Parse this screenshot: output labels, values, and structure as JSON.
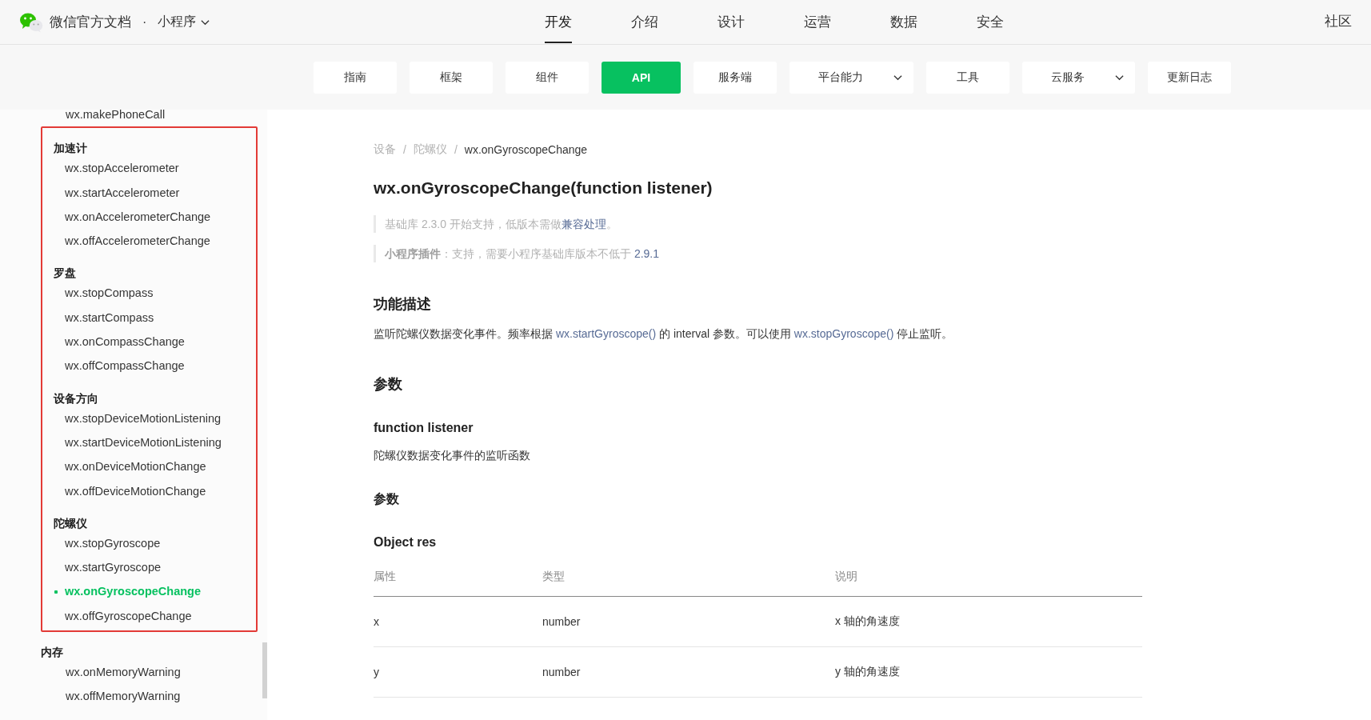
{
  "header": {
    "brand": "微信官方文档",
    "separator": "·",
    "product": "小程序",
    "community": "社区",
    "nav": [
      {
        "label": "开发",
        "selected": true
      },
      {
        "label": "介绍",
        "selected": false
      },
      {
        "label": "设计",
        "selected": false
      },
      {
        "label": "运营",
        "selected": false
      },
      {
        "label": "数据",
        "selected": false
      },
      {
        "label": "安全",
        "selected": false
      }
    ]
  },
  "subnav": [
    {
      "label": "指南",
      "selected": false,
      "dropdown": false
    },
    {
      "label": "框架",
      "selected": false,
      "dropdown": false
    },
    {
      "label": "组件",
      "selected": false,
      "dropdown": false
    },
    {
      "label": "API",
      "selected": true,
      "dropdown": false
    },
    {
      "label": "服务端",
      "selected": false,
      "dropdown": false
    },
    {
      "label": "平台能力",
      "selected": false,
      "dropdown": true
    },
    {
      "label": "工具",
      "selected": false,
      "dropdown": false
    },
    {
      "label": "云服务",
      "selected": false,
      "dropdown": true
    },
    {
      "label": "更新日志",
      "selected": false,
      "dropdown": false
    }
  ],
  "sidebar": {
    "groups": [
      {
        "highlighted": false,
        "items": [
          {
            "label": "wx.makePhoneCall",
            "selected": false
          }
        ]
      },
      {
        "title": "加速计",
        "highlighted": true,
        "items": [
          {
            "label": "wx.stopAccelerometer",
            "selected": false
          },
          {
            "label": "wx.startAccelerometer",
            "selected": false
          },
          {
            "label": "wx.onAccelerometerChange",
            "selected": false
          },
          {
            "label": "wx.offAccelerometerChange",
            "selected": false
          }
        ]
      },
      {
        "title": "罗盘",
        "highlighted": true,
        "items": [
          {
            "label": "wx.stopCompass",
            "selected": false
          },
          {
            "label": "wx.startCompass",
            "selected": false
          },
          {
            "label": "wx.onCompassChange",
            "selected": false
          },
          {
            "label": "wx.offCompassChange",
            "selected": false
          }
        ]
      },
      {
        "title": "设备方向",
        "highlighted": true,
        "items": [
          {
            "label": "wx.stopDeviceMotionListening",
            "selected": false
          },
          {
            "label": "wx.startDeviceMotionListening",
            "selected": false
          },
          {
            "label": "wx.onDeviceMotionChange",
            "selected": false
          },
          {
            "label": "wx.offDeviceMotionChange",
            "selected": false
          }
        ]
      },
      {
        "title": "陀螺仪",
        "highlighted": true,
        "items": [
          {
            "label": "wx.stopGyroscope",
            "selected": false
          },
          {
            "label": "wx.startGyroscope",
            "selected": false
          },
          {
            "label": "wx.onGyroscopeChange",
            "selected": true
          },
          {
            "label": "wx.offGyroscopeChange",
            "selected": false
          }
        ]
      },
      {
        "title": "内存",
        "highlighted": false,
        "items": [
          {
            "label": "wx.onMemoryWarning",
            "selected": false
          },
          {
            "label": "wx.offMemoryWarning",
            "selected": false
          }
        ]
      }
    ]
  },
  "content": {
    "breadcrumb": {
      "separator": "/",
      "items": [
        "设备",
        "陀螺仪",
        "wx.onGyroscopeChange"
      ]
    },
    "title": "wx.onGyroscopeChange(function listener)",
    "notes": [
      [
        {
          "kind": "text",
          "text": "基础库 2.3.0 开始支持，低版本需做"
        },
        {
          "kind": "link",
          "text": "兼容处理"
        },
        {
          "kind": "text",
          "text": "。"
        }
      ],
      [
        {
          "kind": "text",
          "text": "**小程序插件**：支持，需要小程序基础库版本不低于 "
        },
        {
          "kind": "link",
          "text": "2.9.1"
        }
      ]
    ],
    "blocks": [
      {
        "kind": "heading",
        "text": "功能描述"
      },
      {
        "kind": "paragraph",
        "segments": [
          {
            "kind": "text",
            "text": "监听陀螺仪数据变化事件。频率根据 "
          },
          {
            "kind": "link",
            "text": "wx.startGyroscope()"
          },
          {
            "kind": "text",
            "text": " 的 interval 参数。可以使用 "
          },
          {
            "kind": "link",
            "text": "wx.stopGyroscope()"
          },
          {
            "kind": "text",
            "text": " 停止监听。"
          }
        ]
      },
      {
        "kind": "heading",
        "text": "参数"
      },
      {
        "kind": "subheading",
        "text": "function listener"
      },
      {
        "kind": "paragraph",
        "segments": [
          {
            "kind": "text",
            "text": "陀螺仪数据变化事件的监听函数"
          }
        ]
      },
      {
        "kind": "subheading",
        "text": "参数"
      },
      {
        "kind": "subheading",
        "text": "Object res"
      },
      {
        "kind": "table",
        "columns": [
          "属性",
          "类型",
          "说明"
        ],
        "rows": [
          [
            "x",
            "number",
            "x 轴的角速度"
          ],
          [
            "y",
            "number",
            "y 轴的角速度"
          ]
        ]
      }
    ]
  }
}
